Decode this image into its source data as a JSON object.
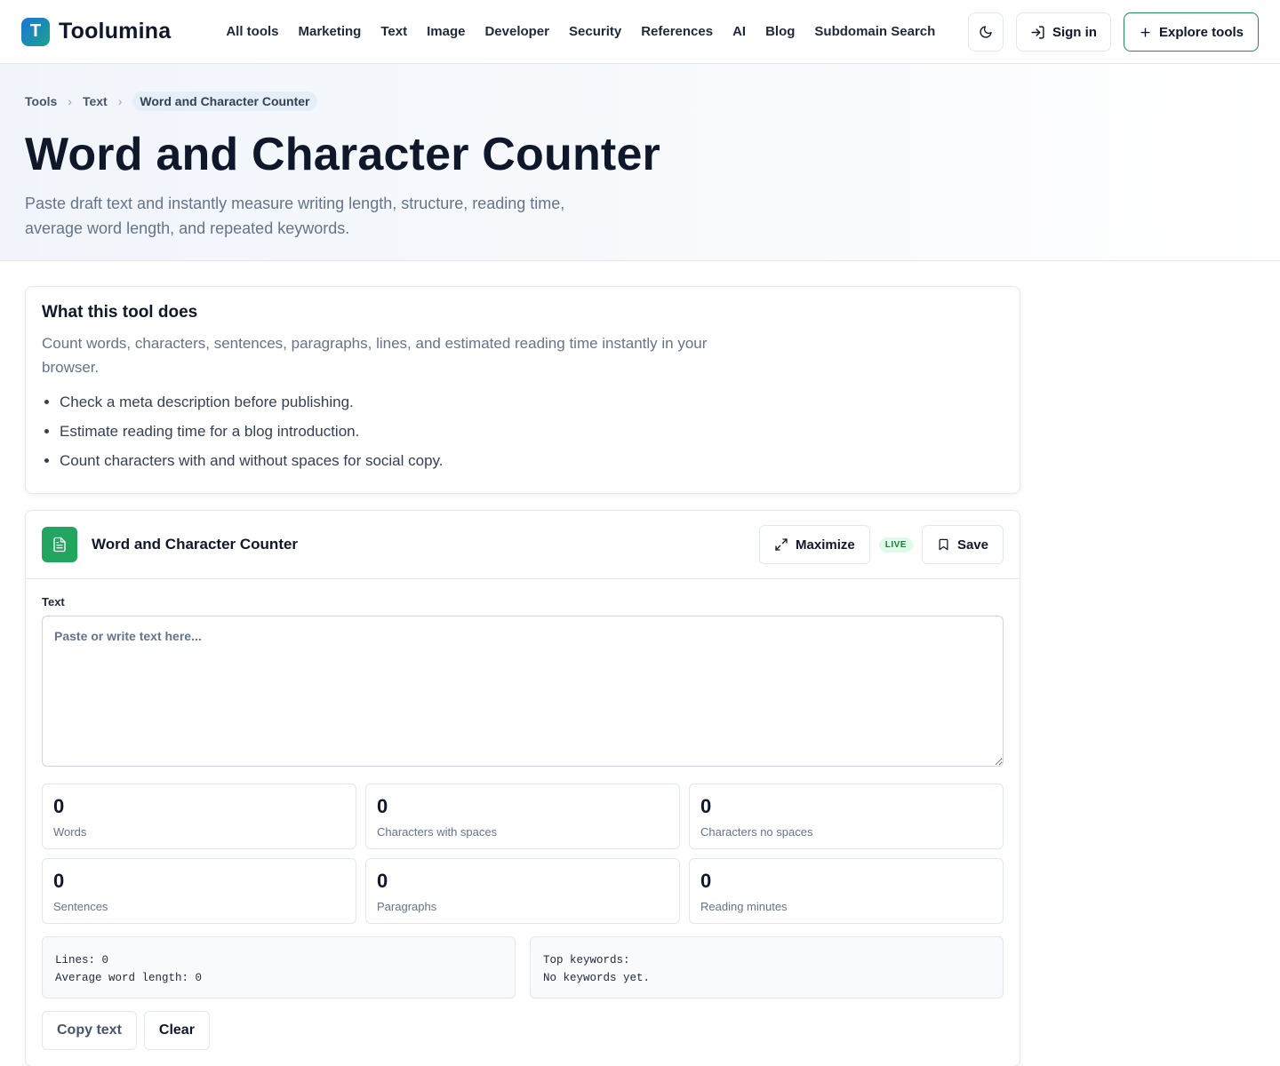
{
  "header": {
    "logo_letter": "T",
    "brand": "Toolumina",
    "nav": [
      "All tools",
      "Marketing",
      "Text",
      "Image",
      "Developer",
      "Security",
      "References",
      "AI",
      "Blog",
      "Subdomain Search"
    ],
    "theme_toggle_icon": "moon-icon",
    "sign_in": "Sign in",
    "explore": "Explore tools"
  },
  "breadcrumb": {
    "items": [
      "Tools",
      "Text"
    ],
    "current": "Word and Character Counter"
  },
  "hero": {
    "title": "Word and Character Counter",
    "description": "Paste draft text and instantly measure writing length, structure, reading time, average word length, and repeated keywords."
  },
  "about": {
    "heading": "What this tool does",
    "text": "Count words, characters, sentences, paragraphs, lines, and estimated reading time instantly in your browser.",
    "bullets": [
      "Check a meta description before publishing.",
      "Estimate reading time for a blog introduction.",
      "Count characters with and without spaces for social copy."
    ]
  },
  "tool": {
    "name": "Word and Character Counter",
    "maximize": "Maximize",
    "live": "LIVE",
    "save": "Save",
    "field_label": "Text",
    "placeholder": "Paste or write text here...",
    "value": "",
    "stats": [
      {
        "value": "0",
        "label": "Words"
      },
      {
        "value": "0",
        "label": "Characters with spaces"
      },
      {
        "value": "0",
        "label": "Characters no spaces"
      },
      {
        "value": "0",
        "label": "Sentences"
      },
      {
        "value": "0",
        "label": "Paragraphs"
      },
      {
        "value": "0",
        "label": "Reading minutes"
      }
    ],
    "lines": "Lines: 0",
    "avg_word": "Average word length: 0",
    "keywords_title": "Top keywords:",
    "keywords_value": "No keywords yet.",
    "copy": "Copy text",
    "clear": "Clear"
  },
  "colors": {
    "accent_green": "#1f8a5a",
    "tool_icon_bg": "#22a55f",
    "live_badge": "#15803d"
  }
}
